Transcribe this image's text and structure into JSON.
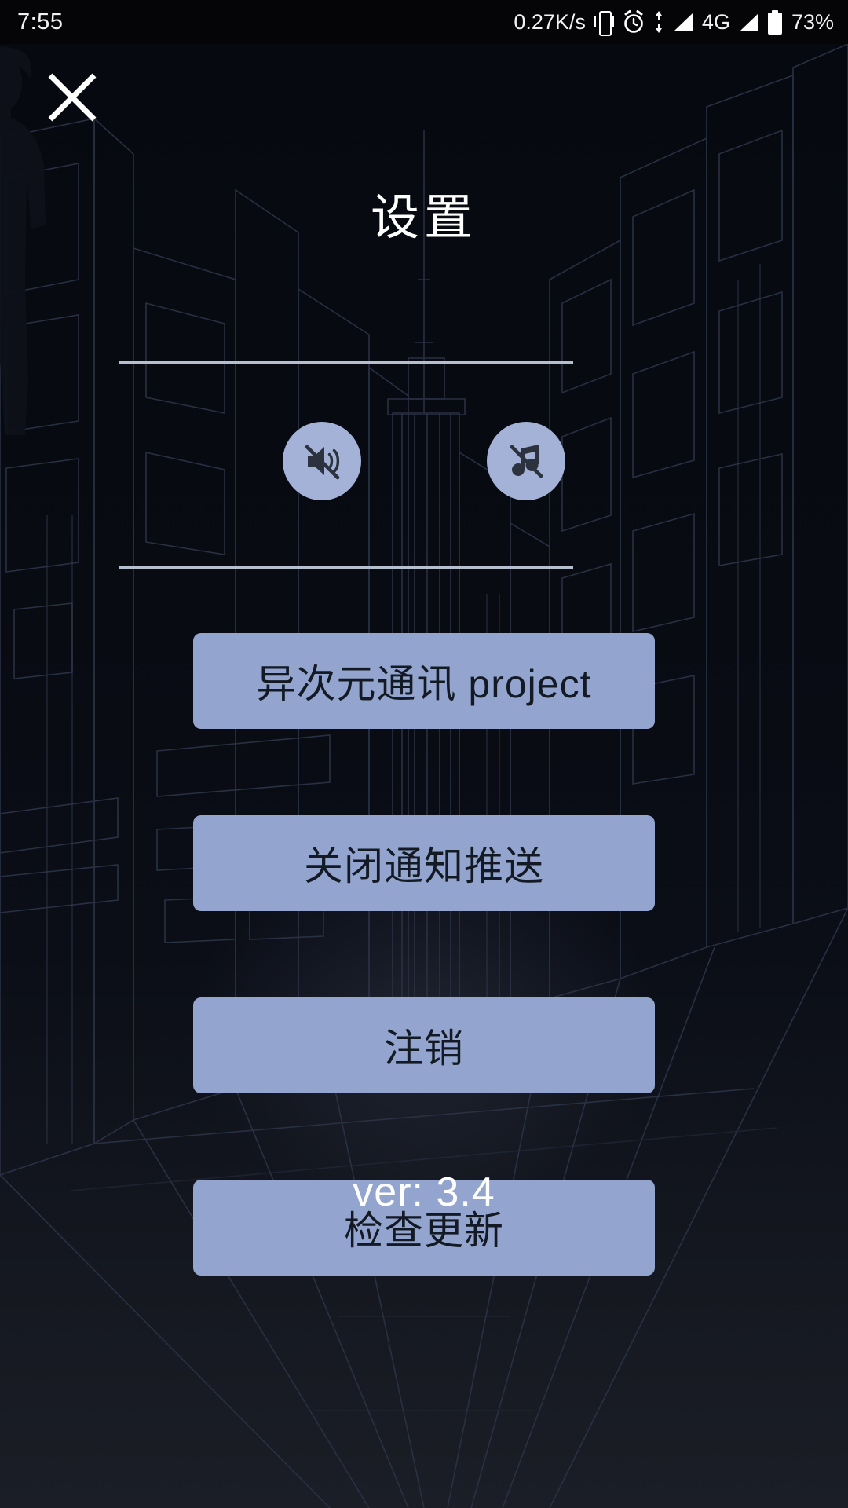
{
  "statusbar": {
    "time": "7:55",
    "network_speed": "0.27K/s",
    "network_type": "4G",
    "battery_percent": "73%",
    "icons": [
      "vibrate-icon",
      "alarm-icon",
      "data-transfer-icon",
      "signal-icon",
      "signal-icon-2",
      "battery-icon"
    ]
  },
  "header": {
    "close_label": "×",
    "title": "设置"
  },
  "toggles": [
    {
      "name": "sound-off-toggle",
      "icon": "volume-off-icon",
      "state": "off"
    },
    {
      "name": "music-off-toggle",
      "icon": "music-off-icon",
      "state": "off"
    }
  ],
  "menu": {
    "items": [
      {
        "label": "异次元通讯 project"
      },
      {
        "label": "关闭通知推送"
      },
      {
        "label": "注销"
      },
      {
        "label": "检查更新"
      }
    ]
  },
  "footer": {
    "version": "ver: 3.4"
  },
  "colors": {
    "accent": "#93a5ce",
    "circle": "#a3b2d6",
    "button_text": "#131a24",
    "divider": "#b6bfcd",
    "background": "#090b13",
    "status_text": "#f2f2f2"
  }
}
